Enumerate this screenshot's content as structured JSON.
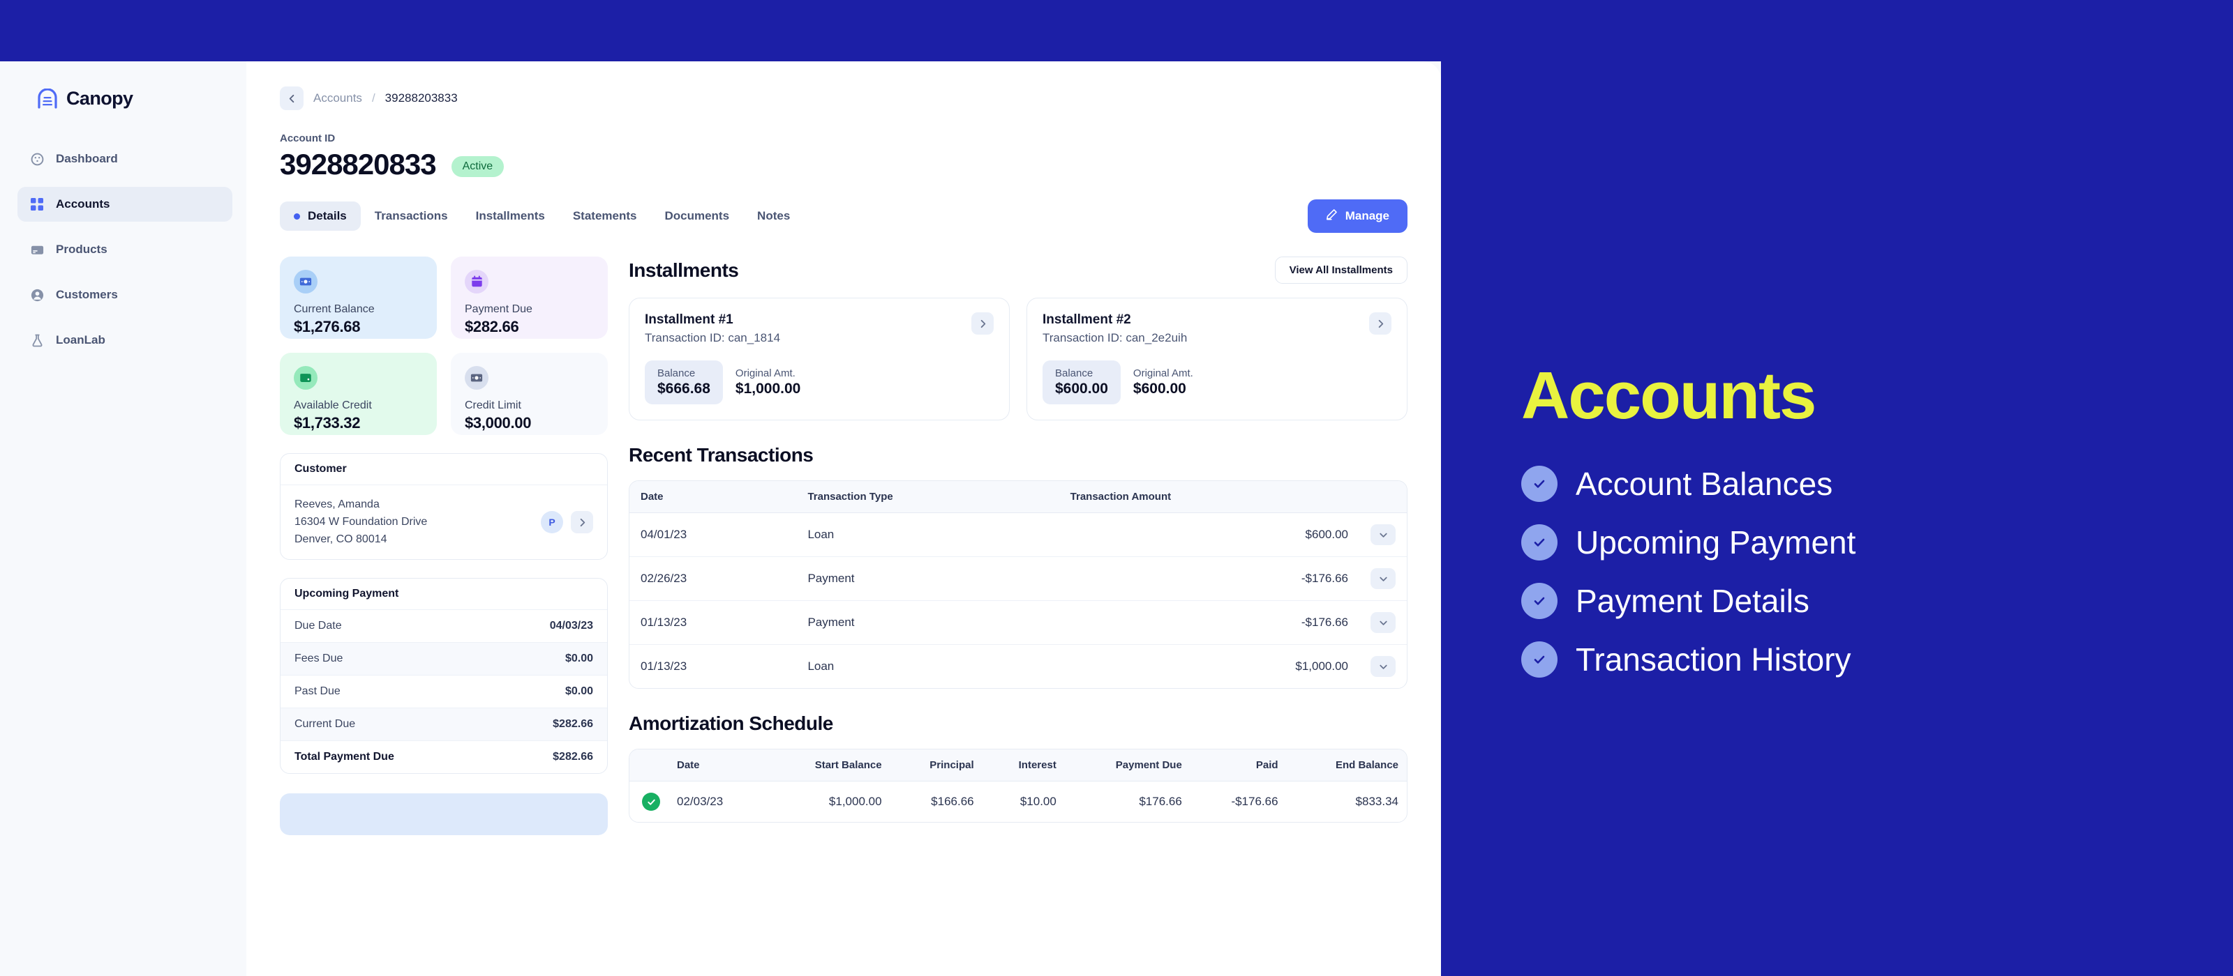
{
  "sidebar": {
    "logo_text": "Canopy",
    "items": [
      {
        "label": "Dashboard",
        "icon": "gauge-icon",
        "active": false
      },
      {
        "label": "Accounts",
        "icon": "grid-icon",
        "active": true
      },
      {
        "label": "Products",
        "icon": "card-icon",
        "active": false
      },
      {
        "label": "Customers",
        "icon": "user-icon",
        "active": false
      },
      {
        "label": "LoanLab",
        "icon": "flask-icon",
        "active": false
      }
    ]
  },
  "breadcrumb": {
    "parent": "Accounts",
    "separator": "/",
    "current": "39288203833"
  },
  "account": {
    "id_label": "Account ID",
    "id": "3928820833",
    "status": "Active"
  },
  "tabs": [
    {
      "label": "Details",
      "active": true
    },
    {
      "label": "Transactions",
      "active": false
    },
    {
      "label": "Installments",
      "active": false
    },
    {
      "label": "Statements",
      "active": false
    },
    {
      "label": "Documents",
      "active": false
    },
    {
      "label": "Notes",
      "active": false
    }
  ],
  "manage_button": {
    "label": "Manage",
    "icon": "pencil-icon"
  },
  "stats": [
    {
      "label": "Current Balance",
      "value": "$1,276.68",
      "icon": "cash-icon",
      "bg": "#E0EEFC",
      "icon_bg": "#A9CFF7",
      "icon_color": "#3F6AD8"
    },
    {
      "label": "Payment Due",
      "value": "$282.66",
      "icon": "calendar-icon",
      "bg": "#F6F1FD",
      "icon_bg": "#E4D6FA",
      "icon_color": "#7C3DEC"
    },
    {
      "label": "Available Credit",
      "value": "$1,733.32",
      "icon": "wallet-icon",
      "bg": "#E2FAEC",
      "icon_bg": "#95E9BB",
      "icon_color": "#0E9457"
    },
    {
      "label": "Credit Limit",
      "value": "$3,000.00",
      "icon": "cash-icon",
      "bg": "#F7F9FD",
      "icon_bg": "#D8DFEE",
      "icon_color": "#5A6480"
    }
  ],
  "customer": {
    "title": "Customer",
    "name": "Reeves, Amanda",
    "address_line1": "16304 W Foundation Drive",
    "address_line2": "Denver, CO 80014",
    "badge": "P",
    "chevron": "chevron-right-icon"
  },
  "upcoming_payment": {
    "title": "Upcoming Payment",
    "rows": [
      {
        "label": "Due Date",
        "value": "04/03/23",
        "alt": false,
        "total": false
      },
      {
        "label": "Fees Due",
        "value": "$0.00",
        "alt": true,
        "total": false
      },
      {
        "label": "Past Due",
        "value": "$0.00",
        "alt": false,
        "total": false
      },
      {
        "label": "Current Due",
        "value": "$282.66",
        "alt": true,
        "total": false
      },
      {
        "label": "Total Payment Due",
        "value": "$282.66",
        "alt": false,
        "total": true
      }
    ]
  },
  "installments": {
    "title": "Installments",
    "view_all_label": "View All Installments",
    "balance_label": "Balance",
    "original_label": "Original Amt.",
    "cards": [
      {
        "name": "Installment #1",
        "txn": "Transaction ID: can_1814",
        "balance": "$666.68",
        "original": "$1,000.00"
      },
      {
        "name": "Installment #2",
        "txn": "Transaction ID: can_2e2uih",
        "balance": "$600.00",
        "original": "$600.00"
      }
    ]
  },
  "recent_transactions": {
    "title": "Recent Transactions",
    "columns": [
      "Date",
      "Transaction Type",
      "Transaction Amount"
    ],
    "rows": [
      {
        "date": "04/01/23",
        "type": "Loan",
        "amount": "$600.00",
        "negative": false
      },
      {
        "date": "02/26/23",
        "type": "Payment",
        "amount": "-$176.66",
        "negative": true
      },
      {
        "date": "01/13/23",
        "type": "Payment",
        "amount": "-$176.66",
        "negative": true
      },
      {
        "date": "01/13/23",
        "type": "Loan",
        "amount": "$1,000.00",
        "negative": false
      }
    ]
  },
  "amortization": {
    "title": "Amortization Schedule",
    "columns": [
      "Date",
      "Start Balance",
      "Principal",
      "Interest",
      "Payment Due",
      "Paid",
      "End Balance"
    ],
    "rows": [
      {
        "paid_check": true,
        "date": "02/03/23",
        "start_balance": "$1,000.00",
        "principal": "$166.66",
        "interest": "$10.00",
        "payment_due": "$176.66",
        "paid": "-$176.66",
        "end_balance": "$833.34"
      }
    ]
  },
  "promo": {
    "title": "Accounts",
    "items": [
      {
        "label": "Account Balances"
      },
      {
        "label": "Upcoming Payment"
      },
      {
        "label": "Payment Details"
      },
      {
        "label": "Transaction History"
      }
    ]
  },
  "colors": {
    "brand_blue": "#1C1FA6",
    "accent_yellow": "#E9F23F",
    "primary_action": "#4F6BF6",
    "positive_green": "#17A05C",
    "status_badge_bg": "#B4F2CE"
  }
}
